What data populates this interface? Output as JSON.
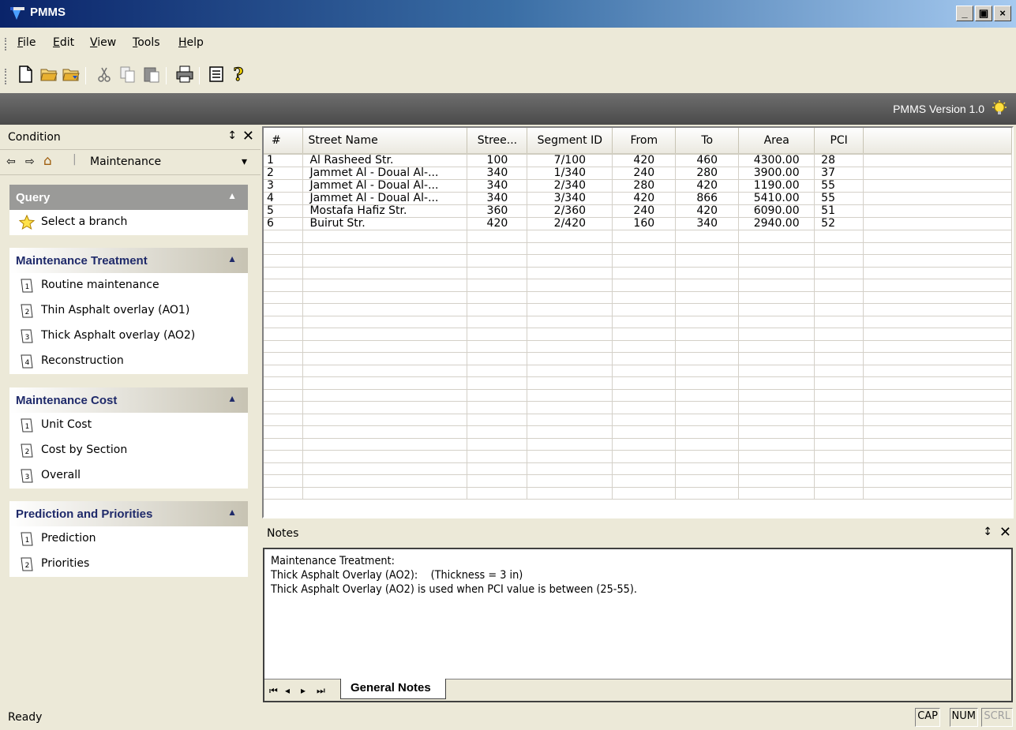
{
  "window": {
    "title": "PMMS",
    "buttons": [
      "_",
      "▣",
      "×"
    ]
  },
  "menu": [
    {
      "label": "File",
      "accel": "F"
    },
    {
      "label": "Edit",
      "accel": "E"
    },
    {
      "label": "View",
      "accel": "V"
    },
    {
      "label": "Tools",
      "accel": "T"
    },
    {
      "label": "Help",
      "accel": "H"
    }
  ],
  "toolbar": {
    "icons": [
      "new-document-icon",
      "open-folder-icon",
      "open-folder-arrow-icon",
      "cut-icon",
      "copy-icon",
      "paste-icon",
      "print-icon",
      "properties-icon",
      "help-icon"
    ]
  },
  "version_bar": {
    "text": "PMMS Version 1.0",
    "icon": "lightbulb-icon"
  },
  "left_panel": {
    "title": "Condition",
    "pin": "↕",
    "close": "✕",
    "nav": {
      "back": "⇦",
      "forward": "⇨",
      "home": "⌂",
      "current": "Maintenance",
      "dropdown": "▾"
    },
    "groups": [
      {
        "title": "Query",
        "style": "dark",
        "items": [
          {
            "label": "Select a branch",
            "icon": "star-icon"
          }
        ]
      },
      {
        "title": "Maintenance Treatment",
        "style": "light",
        "items": [
          {
            "label": "Routine maintenance",
            "icon": "step-1-icon"
          },
          {
            "label": "Thin Asphalt overlay (AO1)",
            "icon": "step-2-icon"
          },
          {
            "label": "Thick Asphalt overlay (AO2)",
            "icon": "step-3-icon"
          },
          {
            "label": "Reconstruction",
            "icon": "step-4-icon"
          }
        ]
      },
      {
        "title": "Maintenance Cost",
        "style": "light",
        "items": [
          {
            "label": "Unit Cost",
            "icon": "step-1-icon"
          },
          {
            "label": "Cost by Section",
            "icon": "step-2-icon"
          },
          {
            "label": "Overall",
            "icon": "step-3-icon"
          }
        ]
      },
      {
        "title": "Prediction and Priorities",
        "style": "light",
        "items": [
          {
            "label": "Prediction",
            "icon": "step-1-icon"
          },
          {
            "label": "Priorities",
            "icon": "step-2-icon"
          }
        ]
      }
    ]
  },
  "grid": {
    "columns": [
      "#",
      "Street Name",
      "Stree...",
      "Segment ID",
      "From",
      "To",
      "Area",
      "PCI"
    ],
    "rows": [
      [
        "1",
        "Al Rasheed Str.",
        "100",
        "7/100",
        "420",
        "460",
        "4300.00",
        "28"
      ],
      [
        "2",
        "Jammet Al - Doual Al-...",
        "340",
        "1/340",
        "240",
        "280",
        "3900.00",
        "37"
      ],
      [
        "3",
        "Jammet Al - Doual Al-...",
        "340",
        "2/340",
        "280",
        "420",
        "1190.00",
        "55"
      ],
      [
        "4",
        "Jammet Al - Doual Al-...",
        "340",
        "3/340",
        "420",
        "866",
        "5410.00",
        "55"
      ],
      [
        "5",
        "Mostafa Hafiz Str.",
        "360",
        "2/360",
        "240",
        "420",
        "6090.00",
        "51"
      ],
      [
        "6",
        "Buirut Str.",
        "420",
        "2/420",
        "160",
        "340",
        "2940.00",
        "52"
      ]
    ]
  },
  "notes": {
    "title": "Notes",
    "pin": "↕",
    "close": "✕",
    "lines": [
      "Maintenance Treatment:",
      "Thick Asphalt Overlay (AO2):    (Thickness = 3 in)",
      "Thick Asphalt Overlay (AO2) is used when PCI value is between (25-55)."
    ],
    "tab_nav": [
      "⏮",
      "◂",
      "▸",
      "⏭"
    ],
    "active_tab": "General Notes"
  },
  "status_bar": {
    "message": "Ready",
    "indicators": [
      {
        "label": "CAP",
        "active": true
      },
      {
        "label": "NUM",
        "active": true
      },
      {
        "label": "SCRL",
        "active": false
      }
    ]
  }
}
